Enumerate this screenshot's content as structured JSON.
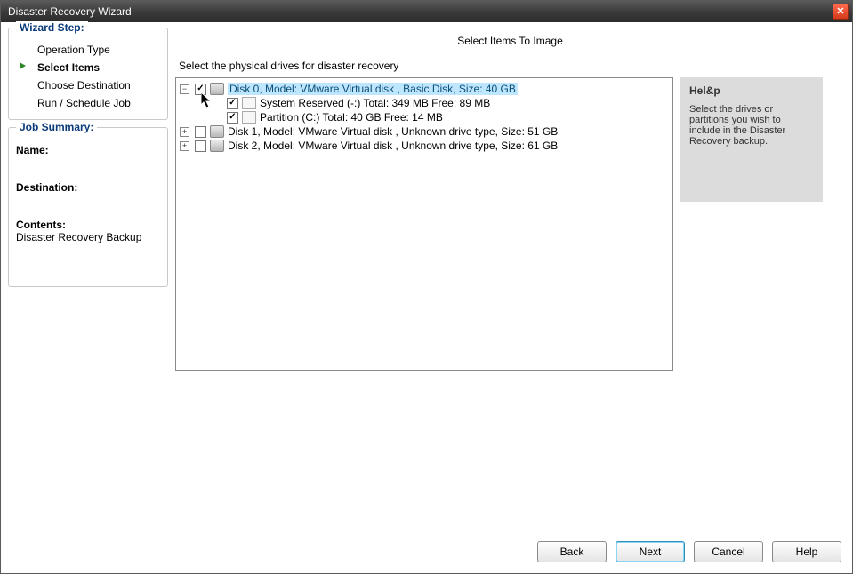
{
  "window": {
    "title": "Disaster Recovery Wizard"
  },
  "wizard_steps": {
    "legend": "Wizard Step:",
    "items": [
      {
        "label": "Operation Type",
        "current": false
      },
      {
        "label": "Select Items",
        "current": true
      },
      {
        "label": "Choose Destination",
        "current": false
      },
      {
        "label": "Run / Schedule Job",
        "current": false
      }
    ]
  },
  "job_summary": {
    "legend": "Job Summary:",
    "name_label": "Name:",
    "name_value": "",
    "destination_label": "Destination:",
    "destination_value": "",
    "contents_label": "Contents:",
    "contents_value": "Disaster Recovery Backup"
  },
  "page": {
    "title": "Select Items To Image",
    "instruction": "Select the physical drives for disaster recovery"
  },
  "tree": [
    {
      "label": "Disk 0, Model: VMware   Virtual disk    , Basic Disk, Size: 40 GB",
      "expanded": true,
      "checked": "tri",
      "selected": true,
      "icon": "disk",
      "children": [
        {
          "label": "System Reserved (-:) Total: 349 MB  Free: 89 MB",
          "checked": true,
          "icon": "part"
        },
        {
          "label": "Partition (C:) Total: 40 GB  Free: 14 MB",
          "checked": true,
          "icon": "part"
        }
      ]
    },
    {
      "label": "Disk 1, Model: VMware   Virtual disk    , Unknown drive type, Size: 51 GB",
      "expanded": false,
      "checked": false,
      "icon": "disk",
      "children": []
    },
    {
      "label": "Disk 2, Model: VMware   Virtual disk    , Unknown drive type, Size: 61 GB",
      "expanded": false,
      "checked": false,
      "icon": "disk",
      "children": []
    }
  ],
  "help": {
    "title": "Hel&p",
    "body": "Select the drives or partitions you wish to include in the Disaster Recovery backup."
  },
  "buttons": {
    "back": "Back",
    "next": "Next",
    "cancel": "Cancel",
    "help": "Help"
  }
}
